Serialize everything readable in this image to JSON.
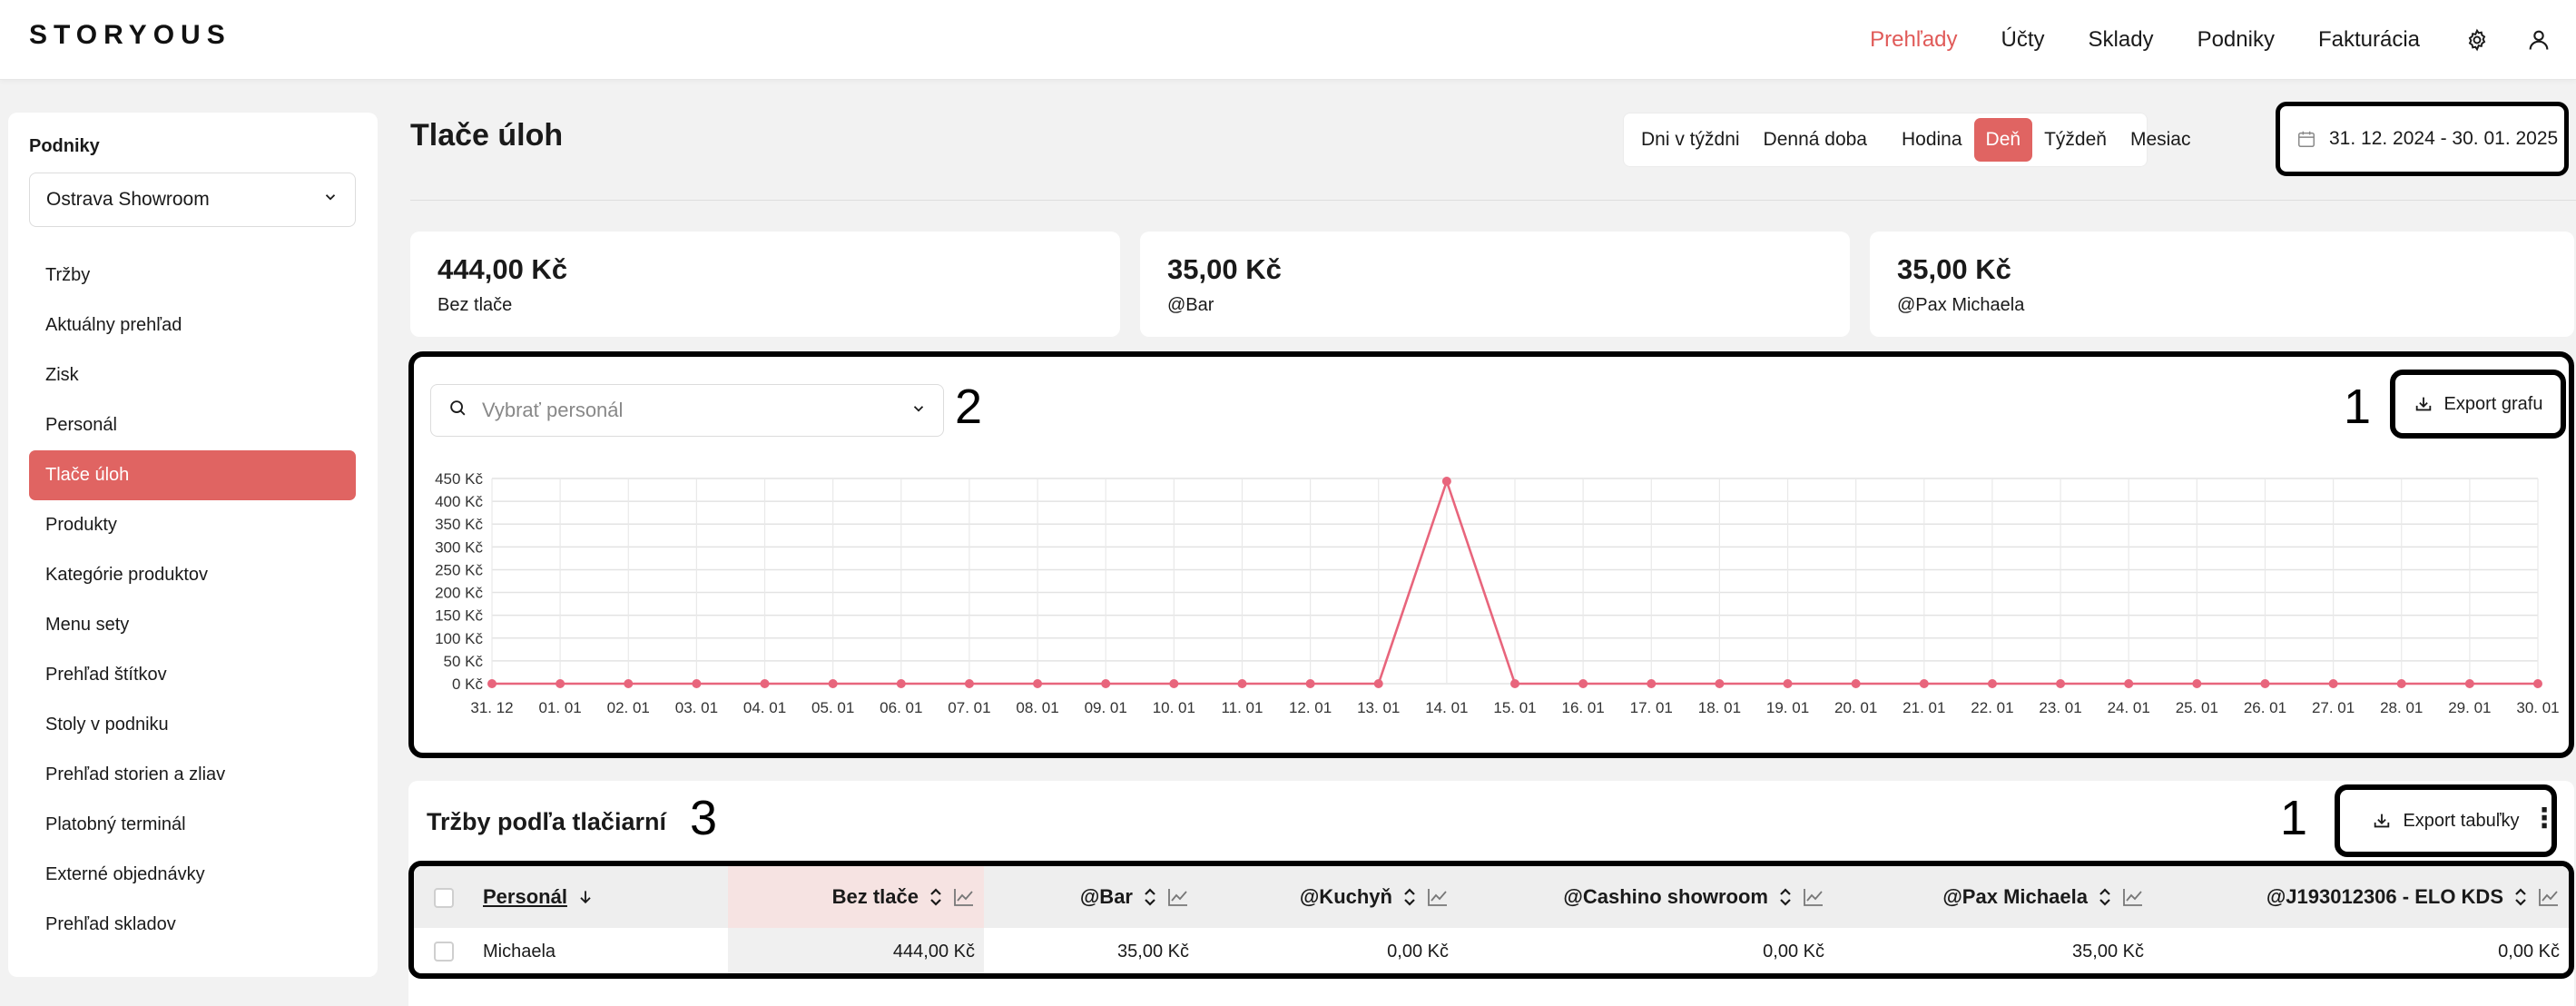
{
  "app": {
    "logo": "STORYOUS"
  },
  "nav": {
    "items": [
      "Prehľady",
      "Účty",
      "Sklady",
      "Podniky",
      "Fakturácia"
    ],
    "active_index": 0,
    "icons": [
      "gear-icon",
      "user-icon"
    ]
  },
  "sidebar": {
    "title": "Podniky",
    "venue_select": "Ostrava Showroom",
    "items": [
      "Tržby",
      "Aktuálny prehľad",
      "Zisk",
      "Personál",
      "Tlače úloh",
      "Produkty",
      "Kategórie produktov",
      "Menu sety",
      "Prehľad štítkov",
      "Stoly v podniku",
      "Prehľad storien a zliav",
      "Platobný terminál",
      "Externé objednávky",
      "Prehľad skladov"
    ],
    "active_index": 4
  },
  "header": {
    "title": "Tlače úloh",
    "segments_left": [
      "Dni v týždni",
      "Denná doba"
    ],
    "segments_right": [
      "Hodina",
      "Deň",
      "Týždeň",
      "Mesiac"
    ],
    "active_segment": "Deň",
    "date_range": "31. 12. 2024 - 30. 01. 2025"
  },
  "kpis": [
    {
      "value": "444,00 Kč",
      "label": "Bez tlače"
    },
    {
      "value": "35,00 Kč",
      "label": "@Bar"
    },
    {
      "value": "35,00 Kč",
      "label": "@Pax Michaela"
    }
  ],
  "chart_panel": {
    "staff_placeholder": "Vybrať personál",
    "annotation_select": "2",
    "annotation_export": "1",
    "export_label": "Export grafu"
  },
  "chart_data": {
    "type": "line",
    "title": "",
    "xlabel": "",
    "ylabel": "",
    "x": [
      "31. 12",
      "01. 01",
      "02. 01",
      "03. 01",
      "04. 01",
      "05. 01",
      "06. 01",
      "07. 01",
      "08. 01",
      "09. 01",
      "10. 01",
      "11. 01",
      "12. 01",
      "13. 01",
      "14. 01",
      "15. 01",
      "16. 01",
      "17. 01",
      "18. 01",
      "19. 01",
      "20. 01",
      "21. 01",
      "22. 01",
      "23. 01",
      "24. 01",
      "25. 01",
      "26. 01",
      "27. 01",
      "28. 01",
      "29. 01",
      "30. 01"
    ],
    "series": [
      {
        "values": [
          0,
          0,
          0,
          0,
          0,
          0,
          0,
          0,
          0,
          0,
          0,
          0,
          0,
          0,
          444,
          0,
          0,
          0,
          0,
          0,
          0,
          0,
          0,
          0,
          0,
          0,
          0,
          0,
          0,
          0,
          0
        ],
        "color": "#e8657c"
      }
    ],
    "y_ticks": [
      "0 Kč",
      "50 Kč",
      "100 Kč",
      "150 Kč",
      "200 Kč",
      "250 Kč",
      "300 Kč",
      "350 Kč",
      "400 Kč",
      "450 Kč"
    ],
    "ylim": [
      0,
      450
    ],
    "grid": true
  },
  "table_panel": {
    "title": "Tržby podľa tlačiarní",
    "annotation_title": "3",
    "annotation_export": "1",
    "export_label": "Export tabuľky",
    "columns": [
      "Personál",
      "Bez tlače",
      "@Bar",
      "@Kuchyň",
      "@Cashino showroom",
      "@Pax Michaela",
      "@J193012306 - ELO KDS"
    ],
    "rows": [
      [
        "Michaela",
        "444,00 Kč",
        "35,00 Kč",
        "0,00 Kč",
        "0,00 Kč",
        "35,00 Kč",
        "0,00 Kč"
      ]
    ]
  },
  "colors": {
    "accent": "#e06462",
    "nav_active": "#e05a58",
    "line": "#e8657c",
    "annotation_frame": "#000000"
  }
}
